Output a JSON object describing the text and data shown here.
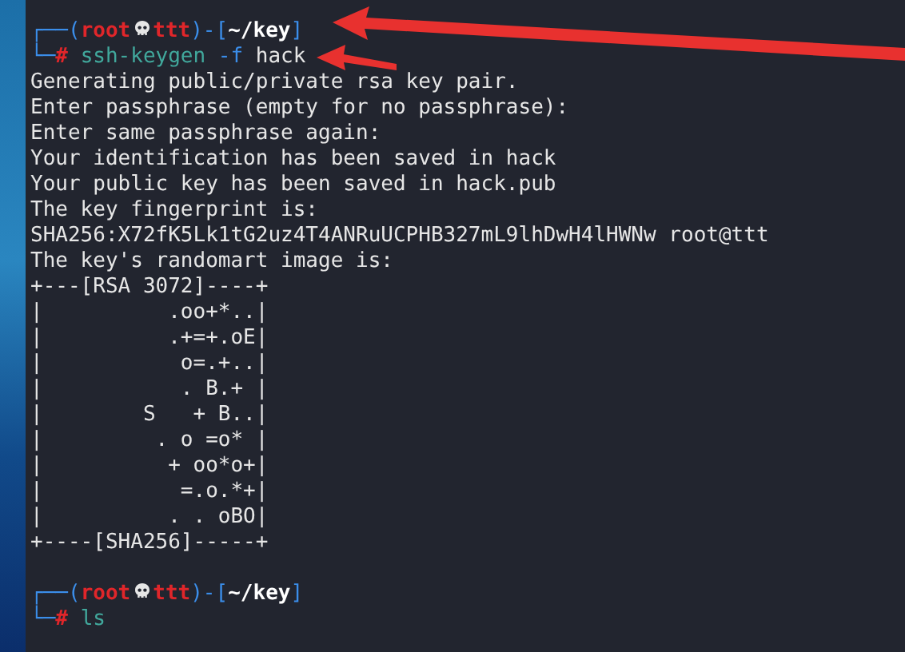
{
  "terminal": {
    "blocks": [
      {
        "kind": "prompt",
        "frame_top": "┌──(",
        "user": "root",
        "host": "ttt",
        "mid": ")-[",
        "path": "~/key",
        "end": "]",
        "frame_bottom": "└─",
        "sign": "#",
        "command": [
          {
            "kind": "program",
            "text": "ssh-keygen"
          },
          {
            "kind": "option",
            "text": "-f"
          },
          {
            "kind": "arg",
            "text": "hack"
          }
        ]
      },
      {
        "kind": "output",
        "lines": [
          "Generating public/private rsa key pair.",
          "Enter passphrase (empty for no passphrase):",
          "Enter same passphrase again:",
          "Your identification has been saved in hack",
          "Your public key has been saved in hack.pub",
          "The key fingerprint is:",
          "SHA256:X72fK5Lk1tG2uz4T4ANRuUCPHB327mL9lhDwH4lHWNw root@ttt",
          "The key's randomart image is:",
          "+---[RSA 3072]----+",
          "|          .oo+*..|",
          "|          .+=+.oE|",
          "|           o=.+..|",
          "|           . B.+ |",
          "|        S   + B..|",
          "|         . o =o* |",
          "|          + oo*o+|",
          "|           =.o.*+|",
          "|          . . oBO|",
          "+----[SHA256]-----+"
        ]
      },
      {
        "kind": "prompt",
        "frame_top": "┌──(",
        "user": "root",
        "host": "ttt",
        "mid": ")-[",
        "path": "~/key",
        "end": "]",
        "frame_bottom": "└─",
        "sign": "#",
        "command": [
          {
            "kind": "program",
            "text": "ls"
          }
        ]
      }
    ]
  }
}
